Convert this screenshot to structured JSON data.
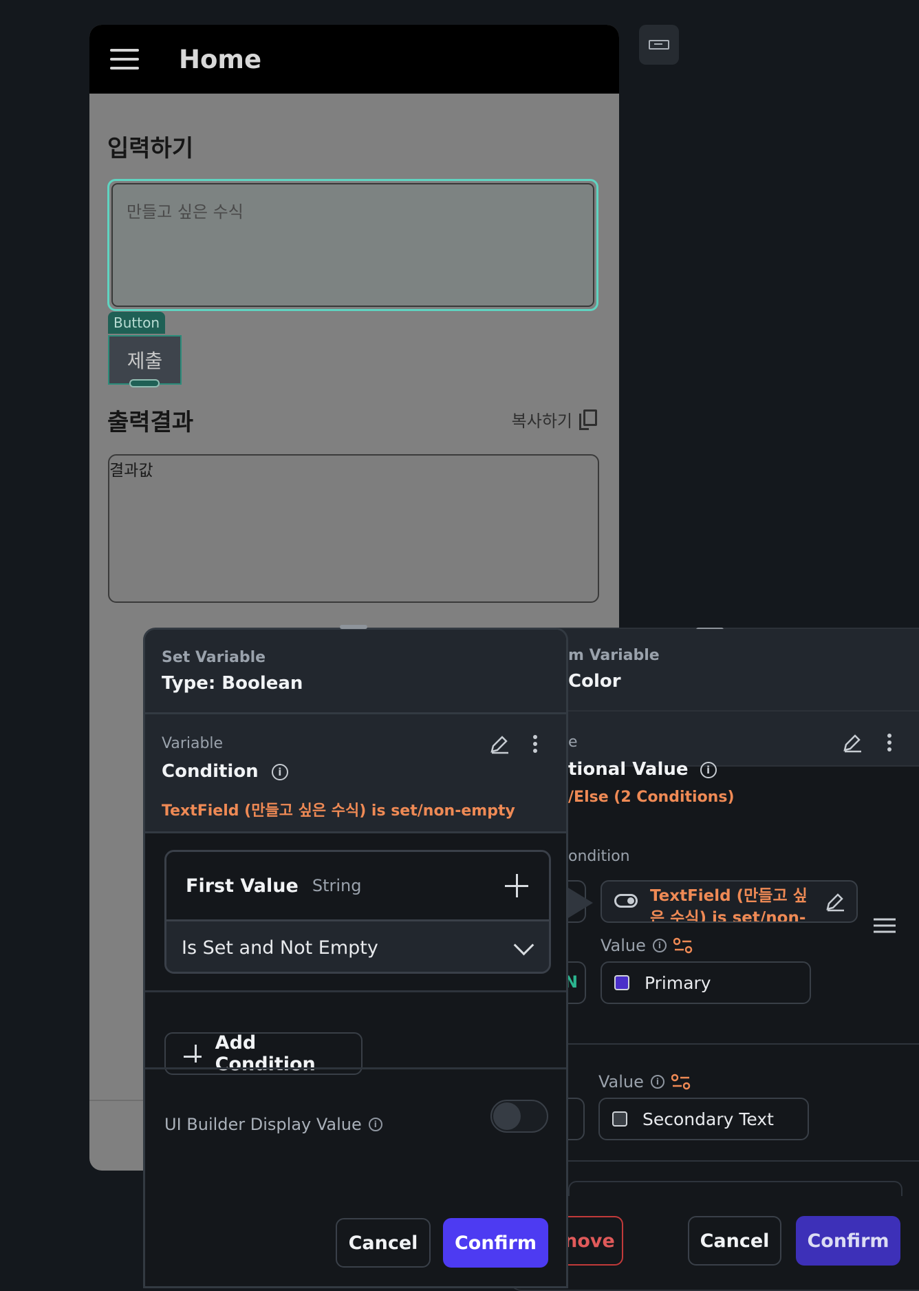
{
  "phone": {
    "appbar_title": "Home",
    "input_heading": "입력하기",
    "input_placeholder": "만들고 싶은 수식",
    "button_tag": "Button",
    "submit_label": "제출",
    "output_heading": "출력결과",
    "copy_label": "복사하기",
    "output_value": "결과값"
  },
  "back_panel": {
    "title_fragment": "m Variable",
    "type_fragment": "Color",
    "variable_fragment": "e",
    "name_fragment": "tional Value",
    "summary_fragment": "/Else (2 Conditions)",
    "condition_label_fragment": "ondition",
    "condition_text": "TextField (만들고 싶은 수식) is set/non-empty",
    "value_label": "Value",
    "value1": "Primary",
    "value1_color": "#4a2fc9",
    "value2": "Secondary Text",
    "value2_color": "#3a3f45",
    "remove_fragment": "nove",
    "cancel": "Cancel",
    "confirm": "Confirm"
  },
  "front_panel": {
    "title": "Set Variable",
    "type": "Type: Boolean",
    "variable_label": "Variable",
    "variable_name": "Condition",
    "summary": "TextField (만들고 싶은 수식) is set/non-empty",
    "first_value_label": "First Value",
    "first_value_type": "String",
    "operator": "Is Set and Not Empty",
    "add_condition": "Add Condition",
    "display_value_label": "UI Builder Display Value",
    "cancel": "Cancel",
    "confirm": "Confirm"
  },
  "colors": {
    "accent": "#4d3bf2",
    "warning_text": "#ef8a55",
    "selection_outline": "#5fd4c1",
    "panel_bg": "#14171b",
    "panel_header_bg": "#22272e"
  }
}
